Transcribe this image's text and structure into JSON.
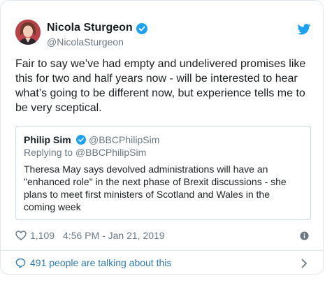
{
  "tweet": {
    "author_name": "Nicola Sturgeon",
    "author_handle": "@NicolaSturgeon",
    "text": "Fair to say we’ve had empty and undelivered promises like this for two and half years now - will be interested to hear what’s going to be different now, but experience tells me to be very sceptical.",
    "likes": "1,109",
    "timestamp": "4:56 PM - Jan 21, 2019",
    "conversation_link": "491 people are talking about this"
  },
  "quoted_tweet": {
    "author_name": "Philip Sim",
    "author_handle": "@BBCPhilipSim",
    "replying_to": "Replying to @BBCPhilipSim",
    "text": "Theresa May says devolved administrations will have an \"enhanced role\" in the next phase of Brexit discussions - she plans to meet first ministers of Scotland and Wales in the coming week"
  },
  "icons": {
    "verified": "verified-badge-icon",
    "brand": "twitter-bird-icon",
    "like": "heart-icon",
    "info": "info-icon",
    "conversation": "speech-bubble-icon",
    "chevron": "chevron-right-icon"
  },
  "colors": {
    "twitter_blue": "#1da1f2",
    "link_blue": "#2b7bb9",
    "muted_text": "#697882",
    "border": "#e1e8ed"
  }
}
